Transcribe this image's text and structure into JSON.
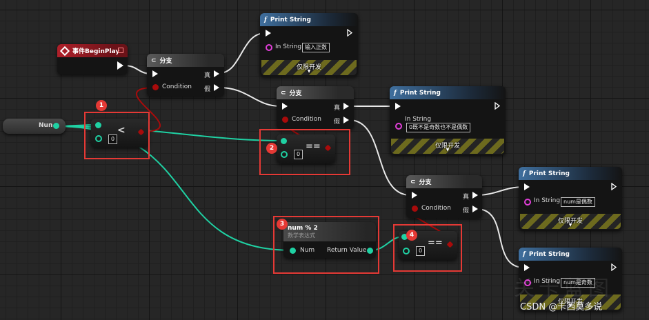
{
  "variable_nun": {
    "label": "Nun"
  },
  "event_node": {
    "title": "事件BeginPlay"
  },
  "branch_nodes": [
    {
      "title": "分支",
      "condition_label": "Condition",
      "true_label": "真",
      "false_label": "假"
    },
    {
      "title": "分支",
      "condition_label": "Condition",
      "true_label": "真",
      "false_label": "假"
    },
    {
      "title": "分支",
      "condition_label": "Condition",
      "true_label": "真",
      "false_label": "假"
    }
  ],
  "print_nodes": [
    {
      "title": "Print String",
      "in_label": "In String",
      "value": "输入正数",
      "dev_only": "仅限开发"
    },
    {
      "title": "Print String",
      "in_label": "In String",
      "value": "0既不是奇数也不是偶数",
      "dev_only": "仅限开发"
    },
    {
      "title": "Print String",
      "in_label": "In String",
      "value": "num是偶数",
      "dev_only": "仅限开发"
    },
    {
      "title": "Print String",
      "in_label": "In String",
      "value": "num是奇数",
      "dev_only": "仅限开发"
    }
  ],
  "compare_nodes": [
    {
      "operator": "<",
      "value": "0"
    },
    {
      "operator": "==",
      "value": "0"
    },
    {
      "operator": "==",
      "value": "0"
    }
  ],
  "math_node": {
    "title": "num % 2",
    "subtitle": "数学表达式",
    "input_label": "Num",
    "output_label": "Return Value"
  },
  "badges": [
    "1",
    "2",
    "3",
    "4"
  ],
  "watermark": "关卡蓝图",
  "credit": "CSDN @卡西莫多说",
  "colors": {
    "exec": "#ffffff",
    "int_pin": "#1fd1a3",
    "string_pin": "#e23fd9",
    "bool_pin": "#a80b0b",
    "annotation": "#e53935"
  }
}
